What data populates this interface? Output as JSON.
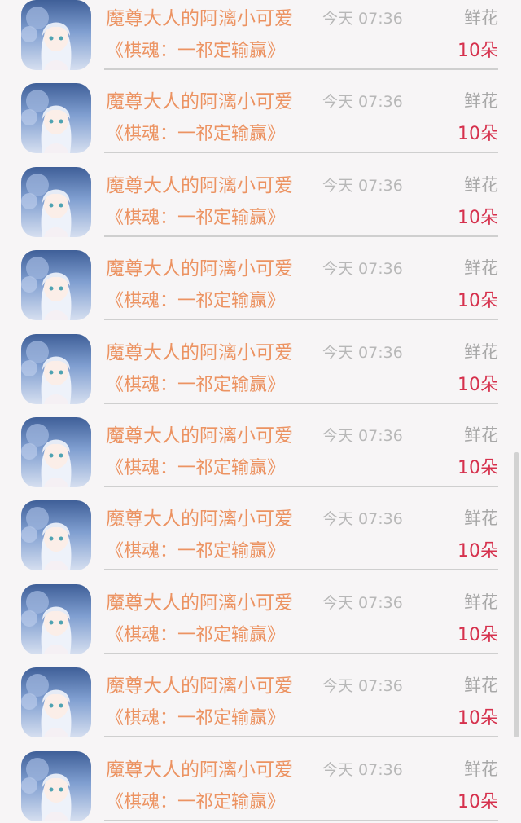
{
  "items": [
    {
      "name": "魔尊大人的阿漓小可爱",
      "time": "今天 07:36",
      "gift": "鲜花",
      "work": "《棋魂：一祁定输赢》",
      "count": "10朵"
    },
    {
      "name": "魔尊大人的阿漓小可爱",
      "time": "今天 07:36",
      "gift": "鲜花",
      "work": "《棋魂：一祁定输赢》",
      "count": "10朵"
    },
    {
      "name": "魔尊大人的阿漓小可爱",
      "time": "今天 07:36",
      "gift": "鲜花",
      "work": "《棋魂：一祁定输赢》",
      "count": "10朵"
    },
    {
      "name": "魔尊大人的阿漓小可爱",
      "time": "今天 07:36",
      "gift": "鲜花",
      "work": "《棋魂：一祁定输赢》",
      "count": "10朵"
    },
    {
      "name": "魔尊大人的阿漓小可爱",
      "time": "今天 07:36",
      "gift": "鲜花",
      "work": "《棋魂：一祁定输赢》",
      "count": "10朵"
    },
    {
      "name": "魔尊大人的阿漓小可爱",
      "time": "今天 07:36",
      "gift": "鲜花",
      "work": "《棋魂：一祁定输赢》",
      "count": "10朵"
    },
    {
      "name": "魔尊大人的阿漓小可爱",
      "time": "今天 07:36",
      "gift": "鲜花",
      "work": "《棋魂：一祁定输赢》",
      "count": "10朵"
    },
    {
      "name": "魔尊大人的阿漓小可爱",
      "time": "今天 07:36",
      "gift": "鲜花",
      "work": "《棋魂：一祁定输赢》",
      "count": "10朵"
    },
    {
      "name": "魔尊大人的阿漓小可爱",
      "time": "今天 07:36",
      "gift": "鲜花",
      "work": "《棋魂：一祁定输赢》",
      "count": "10朵"
    },
    {
      "name": "魔尊大人的阿漓小可爱",
      "time": "今天 07:36",
      "gift": "鲜花",
      "work": "《棋魂：一祁定输赢》",
      "count": "10朵"
    }
  ],
  "colors": {
    "name": "#ec9362",
    "time": "#b8b8b8",
    "gift": "#a8a8a8",
    "count": "#d6314d",
    "background": "#f7f5f6"
  },
  "icons": {
    "avatar": "anime-avatar-icon"
  }
}
